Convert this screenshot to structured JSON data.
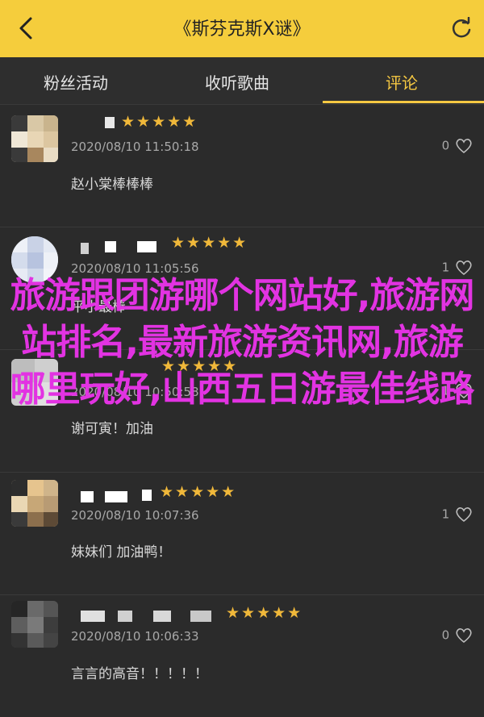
{
  "header": {
    "title": "《斯芬克斯Ⅹ谜》",
    "bg_color": "#f5cd3c"
  },
  "tabs": [
    {
      "label": "粉丝活动"
    },
    {
      "label": "收听歌曲"
    },
    {
      "label": "评论",
      "active": true
    }
  ],
  "accent_color": "#f5c842",
  "comments": [
    {
      "stars": "★★★★★",
      "time": "2020/08/10 11:50:18",
      "likes": "0",
      "text": "赵小棠棒棒棒"
    },
    {
      "stars": "★★★★★",
      "time": "2020/08/10 11:05:56",
      "likes": "1",
      "text": "平小最棒"
    },
    {
      "stars": "★★★★★",
      "time": "2020/08/10 10:50:58",
      "likes": "1",
      "text": "谢可寅！加油"
    },
    {
      "stars": "★★★★★",
      "time": "2020/08/10 10:07:36",
      "likes": "1",
      "text": "妹妹们 加油鸭！"
    },
    {
      "stars": "★★★★★",
      "time": "2020/08/10 10:06:33",
      "likes": "0",
      "text": "言言的高音！！！！！"
    }
  ],
  "overlay_text": "旅游跟团游哪个网站好,旅游网站排名,最新旅游资讯网,旅游哪里玩好,山西五日游最佳线路",
  "overlay_color": "#e233e2"
}
